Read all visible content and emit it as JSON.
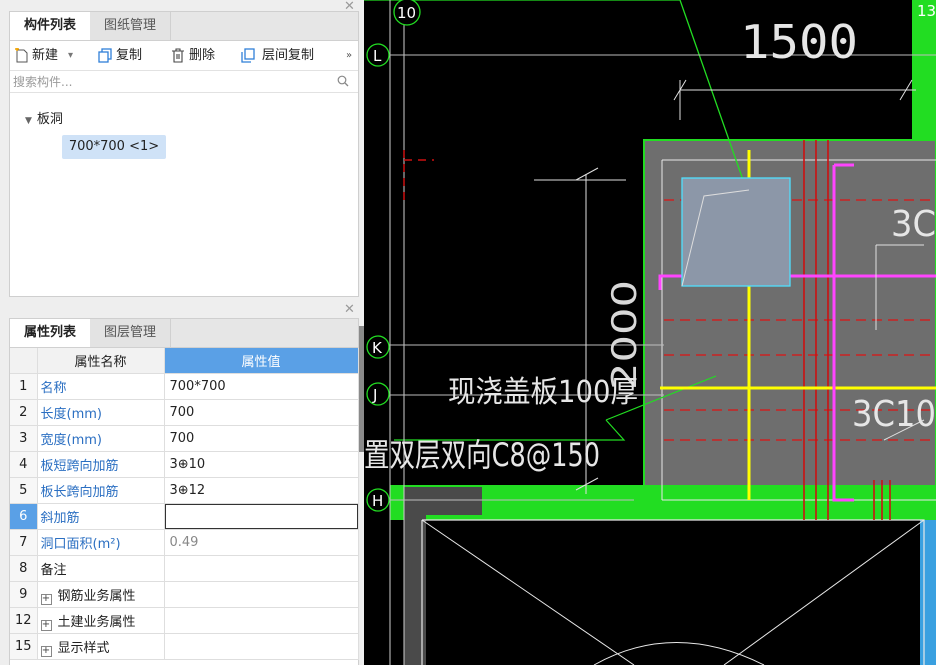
{
  "component_panel": {
    "tabs": [
      "构件列表",
      "图纸管理"
    ],
    "toolbar": {
      "new_label": "新建",
      "copy_label": "复制",
      "delete_label": "删除",
      "floor_copy_label": "层间复制",
      "more_label": "»"
    },
    "search_placeholder": "搜索构件...",
    "tree": {
      "parent_label": "板洞",
      "child_label": "700*700 <1>"
    }
  },
  "property_panel": {
    "tabs": [
      "属性列表",
      "图层管理"
    ],
    "header": {
      "name": "属性名称",
      "value": "属性值"
    },
    "rows": [
      {
        "num": "1",
        "name": "名称",
        "value": "700*700"
      },
      {
        "num": "2",
        "name": "长度(mm)",
        "value": "700"
      },
      {
        "num": "3",
        "name": "宽度(mm)",
        "value": "700"
      },
      {
        "num": "4",
        "name": "板短跨向加筋",
        "value": "3⊕10"
      },
      {
        "num": "5",
        "name": "板长跨向加筋",
        "value": "3⊕12"
      },
      {
        "num": "6",
        "name": "斜加筋",
        "value": ""
      },
      {
        "num": "7",
        "name": "洞口面积(m²)",
        "value": "0.49"
      },
      {
        "num": "8",
        "name": "备注",
        "value": ""
      },
      {
        "num": "9",
        "name": "钢筋业务属性",
        "value": ""
      },
      {
        "num": "12",
        "name": "土建业务属性",
        "value": ""
      },
      {
        "num": "15",
        "name": "显示样式",
        "value": ""
      }
    ]
  },
  "drawing": {
    "axis_labels": [
      "10",
      "13",
      "L",
      "K",
      "J",
      "H"
    ],
    "dimension_top": "1500",
    "dimension_vertical": "2000",
    "note_line1": "现浇盖板100厚",
    "note_line2": "置双层双向C8@150",
    "rebar_label_1": "3C",
    "rebar_label_2": "3C10"
  },
  "colors": {
    "accent_blue": "#5aa0e6",
    "selected_item": "#cfe2f7",
    "cad_green": "#22dd22",
    "cad_yellow": "#ffff00",
    "cad_magenta": "#ff44ff",
    "cad_red": "#cc1111"
  }
}
